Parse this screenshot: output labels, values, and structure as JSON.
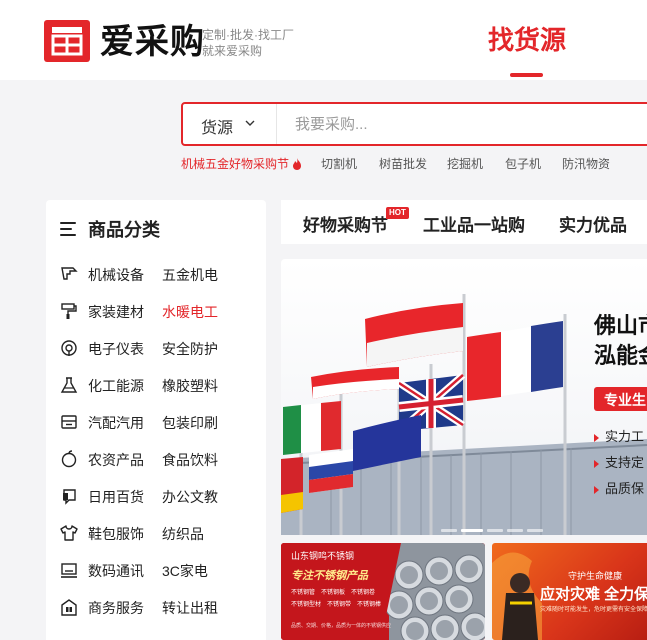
{
  "header": {
    "logo_text": "爱采购",
    "slogan_line1": "定制·批发·找工厂",
    "slogan_line2": "就来爱采购",
    "nav_find": "找货源"
  },
  "search": {
    "category": "货源",
    "placeholder": "我要采购..."
  },
  "hot_tags": [
    "机械五金好物采购节",
    "切割机",
    "树苗批发",
    "挖掘机",
    "包子机",
    "防汛物资"
  ],
  "sidebar": {
    "title": "商品分类",
    "rows": [
      {
        "icon": "drill-icon",
        "a": "机械设备",
        "b": "五金机电"
      },
      {
        "icon": "paint-roller-icon",
        "a": "家装建材",
        "b": "水暖电工"
      },
      {
        "icon": "gauge-icon",
        "a": "电子仪表",
        "b": "安全防护"
      },
      {
        "icon": "flask-icon",
        "a": "化工能源",
        "b": "橡胶塑料"
      },
      {
        "icon": "car-icon",
        "a": "汽配汽用",
        "b": "包装印刷"
      },
      {
        "icon": "apple-icon",
        "a": "农资产品",
        "b": "食品饮料"
      },
      {
        "icon": "cup-icon",
        "a": "日用百货",
        "b": "办公文教"
      },
      {
        "icon": "shirt-icon",
        "a": "鞋包服饰",
        "b": "纺织品"
      },
      {
        "icon": "monitor-icon",
        "a": "数码通讯",
        "b": "3C家电"
      },
      {
        "icon": "business-icon",
        "a": "商务服务",
        "b": "转让出租"
      }
    ]
  },
  "tabs": {
    "items": [
      "好物采购节",
      "工业品一站购",
      "实力优品"
    ],
    "hot_badge": "HOT"
  },
  "banner": {
    "title_line1": "佛山市",
    "title_line2": "泓能金",
    "badge": "专业生",
    "points": [
      "实力工",
      "支持定",
      "品质保"
    ]
  },
  "promo_left": {
    "title": "山东钢鸣不锈钢",
    "main": "专注不锈钢产品",
    "tags": [
      "不锈钢管",
      "不锈钢板",
      "不锈钢卷",
      "不锈钢型材",
      "不锈钢带",
      "不锈钢棒"
    ],
    "footer": "品质、交期、价格，品质为一体的不锈钢供应"
  },
  "promo_right": {
    "sub": "守护生命健康",
    "main": "应对灾难 全力保障",
    "footer": "灾难随时可能发生，危时更需有安全保障"
  },
  "colors": {
    "brand_red": "#e3262a",
    "page_bg": "#f4f4f6"
  }
}
